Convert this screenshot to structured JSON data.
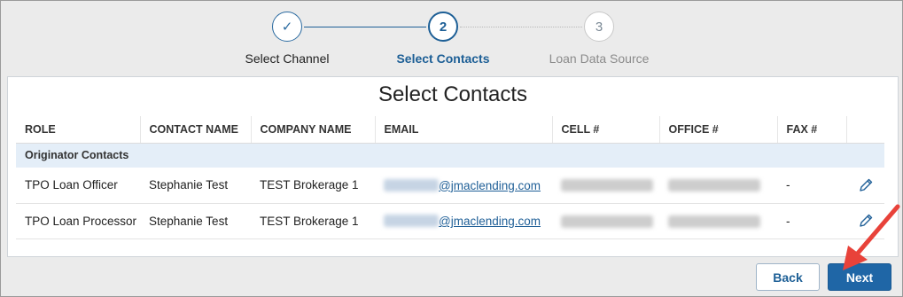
{
  "stepper": {
    "steps": [
      {
        "number": "✓",
        "label": "Select Channel",
        "state": "done"
      },
      {
        "number": "2",
        "label": "Select Contacts",
        "state": "active"
      },
      {
        "number": "3",
        "label": "Loan Data Source",
        "state": "todo"
      }
    ]
  },
  "panel": {
    "title": "Select Contacts"
  },
  "table": {
    "columns": [
      "ROLE",
      "CONTACT NAME",
      "COMPANY NAME",
      "EMAIL",
      "CELL #",
      "OFFICE #",
      "FAX #",
      ""
    ],
    "group_label": "Originator Contacts",
    "rows": [
      {
        "role": "TPO Loan Officer",
        "contact_name": "Stephanie Test",
        "company_name": "TEST Brokerage 1",
        "email_domain": "@jmaclending.com",
        "fax": "-"
      },
      {
        "role": "TPO Loan Processor",
        "contact_name": "Stephanie Test",
        "company_name": "TEST Brokerage 1",
        "email_domain": "@jmaclending.com",
        "fax": "-"
      }
    ]
  },
  "icons": {
    "edit": "pencil-icon",
    "done_step": "checkmark-icon"
  },
  "buttons": {
    "back": "Back",
    "next": "Next"
  },
  "colors": {
    "primary": "#1f66a6",
    "annotation_arrow": "#e8423a",
    "group_row_bg": "#e4eef8"
  }
}
